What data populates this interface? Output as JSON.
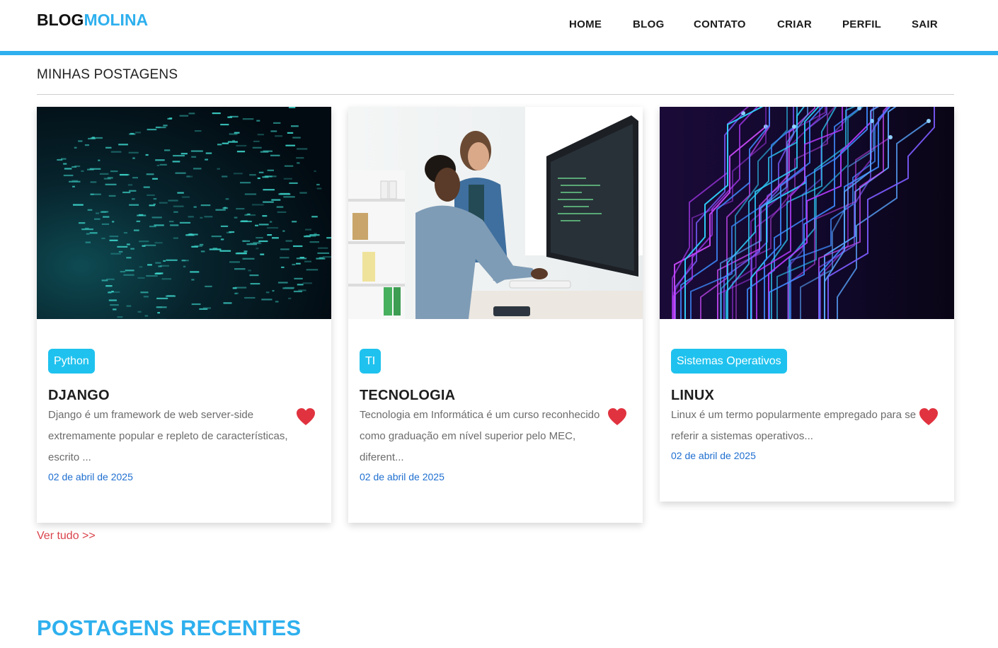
{
  "brand": {
    "part1": "BLOG",
    "part2": "MOLINA",
    "accent": "#2eb0ee"
  },
  "nav": [
    "HOME",
    "BLOG",
    "CONTATO",
    "CRIAR",
    "PERFIL",
    "SAIR"
  ],
  "section": {
    "title": "MINHAS POSTAGENS",
    "see_all": "Ver tudo >>"
  },
  "posts": [
    {
      "tag": "Python",
      "title": "DJANGO",
      "excerpt": "Django é um framework de web server-side extremamente popular e repleto de características, escrito ...",
      "date": "02 de abril de 2025",
      "image": "digital-code-image"
    },
    {
      "tag": "TI",
      "title": "TECNOLOGIA",
      "excerpt": "Tecnologia em Informática é um curso reconhecido como graduação em nível superior pelo MEC, diferent...",
      "date": "02 de abril de 2025",
      "image": "developers-at-computer-photo"
    },
    {
      "tag": "Sistemas Operativos",
      "title": "LINUX",
      "excerpt": "Linux é um termo popularmente empregado para se referir a sistemas operativos...",
      "date": "02 de abril de 2025",
      "image": "circuit-board-image"
    }
  ],
  "recent": {
    "title": "POSTAGENS RECENTES"
  },
  "colors": {
    "badge": "#1fc2ee",
    "heart": "#e0333f",
    "date": "#1f6fd0",
    "link": "#d9434c"
  }
}
